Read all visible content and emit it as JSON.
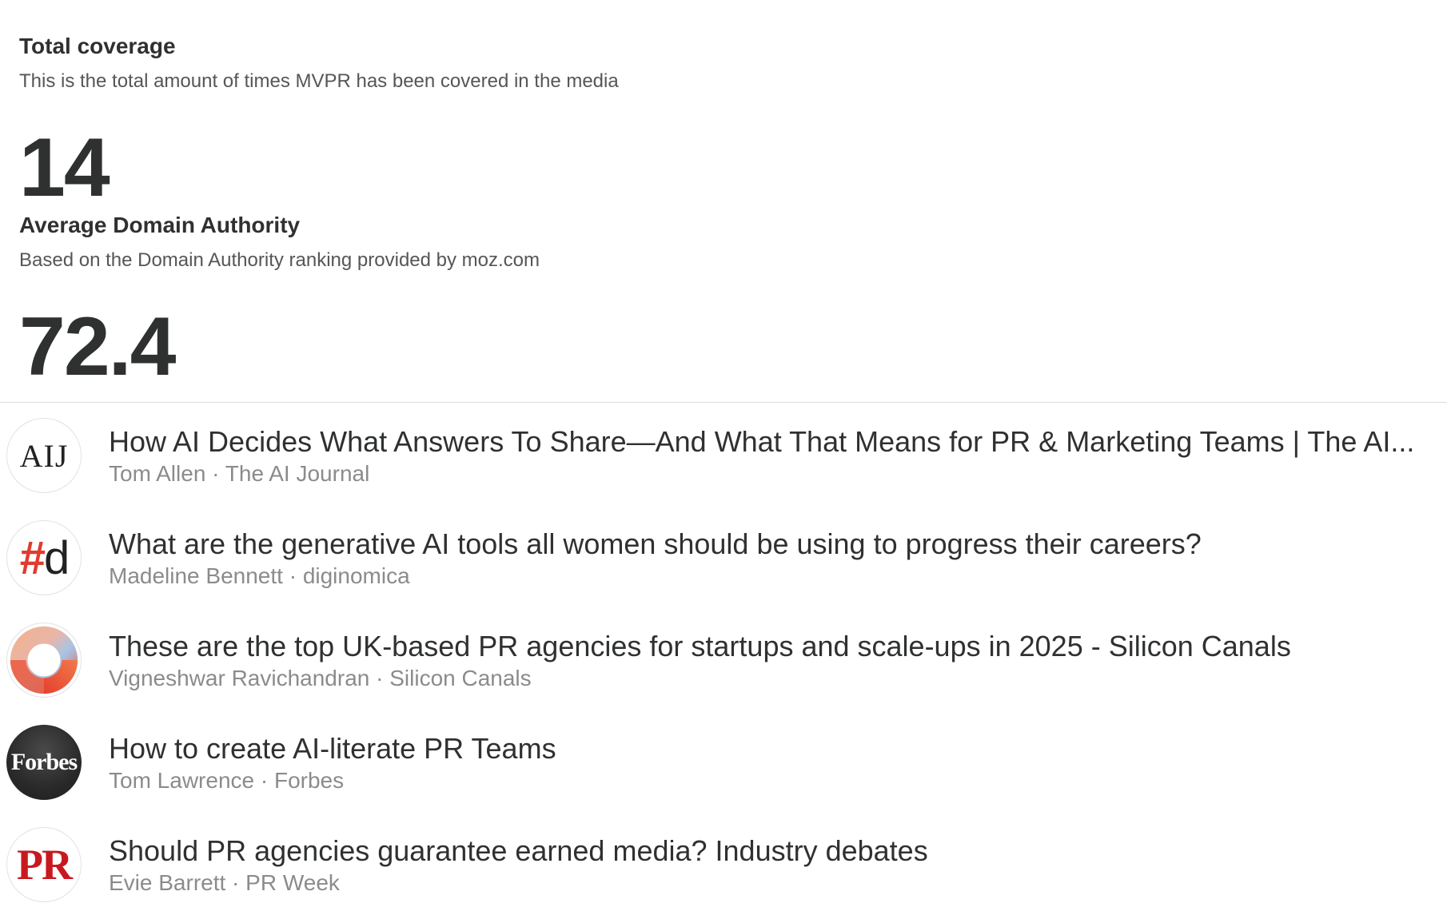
{
  "total_coverage": {
    "title": "Total coverage",
    "description": "This is the total amount of times MVPR has been covered in the media",
    "value": "14"
  },
  "average_domain_authority": {
    "title": "Average Domain Authority",
    "description": "Based on the Domain Authority ranking provided by moz.com",
    "value": "72.4"
  },
  "articles": [
    {
      "title": "How AI Decides What Answers To Share—And What That Means for PR & Marketing Teams | The AI...",
      "meta": "Tom Allen · The AI Journal",
      "logo": {
        "icon": "aij-logo-icon",
        "text": "AIJ"
      }
    },
    {
      "title": "What are the generative AI tools all women should be using to progress their careers?",
      "meta": "Madeline Bennett · diginomica",
      "logo": {
        "icon": "diginomica-logo-icon",
        "hash": "#",
        "letter": "d",
        "accent": "#e03b30"
      }
    },
    {
      "title": "These are the top UK-based PR agencies for startups and scale-ups in 2025 - Silicon Canals",
      "meta": "Vigneshwar Ravichandran · Silicon Canals",
      "logo": {
        "icon": "silicon-canals-logo-icon"
      }
    },
    {
      "title": "How to create AI-literate PR Teams",
      "meta": "Tom Lawrence · Forbes",
      "logo": {
        "icon": "forbes-logo-icon",
        "text": "Forbes"
      }
    },
    {
      "title": "Should PR agencies guarantee earned media? Industry debates",
      "meta": "Evie Barrett · PR Week",
      "logo": {
        "icon": "pr-week-logo-icon",
        "text": "PR",
        "accent": "#c8191f"
      }
    }
  ]
}
